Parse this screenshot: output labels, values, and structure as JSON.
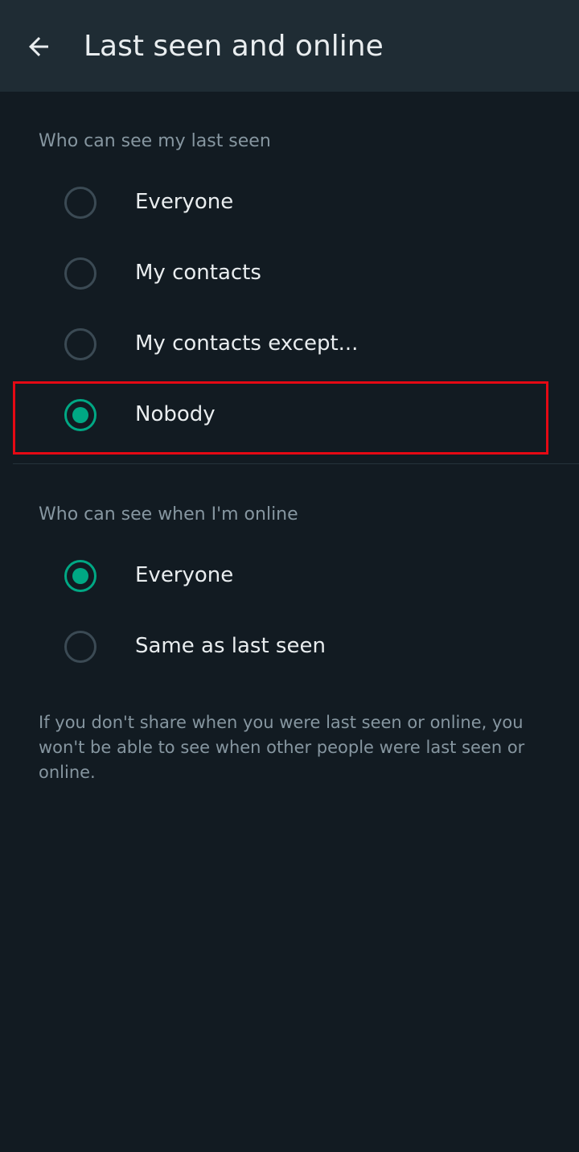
{
  "toolbar": {
    "back_icon": "arrow-left-icon",
    "title": "Last seen and online"
  },
  "last_seen": {
    "label": "Who can see my last seen",
    "options": [
      {
        "label": "Everyone",
        "selected": false
      },
      {
        "label": "My contacts",
        "selected": false
      },
      {
        "label": "My contacts except...",
        "selected": false
      },
      {
        "label": "Nobody",
        "selected": true
      }
    ]
  },
  "online": {
    "label": "Who can see when I'm online",
    "options": [
      {
        "label": "Everyone",
        "selected": true
      },
      {
        "label": "Same as last seen",
        "selected": false
      }
    ]
  },
  "footnote": "If you don't share when you were last seen or online, you won't be able to see when other people were last seen or online.",
  "colors": {
    "background": "#121B22",
    "toolbar": "#1F2C34",
    "accent": "#00A884",
    "highlight": "#E50914"
  }
}
